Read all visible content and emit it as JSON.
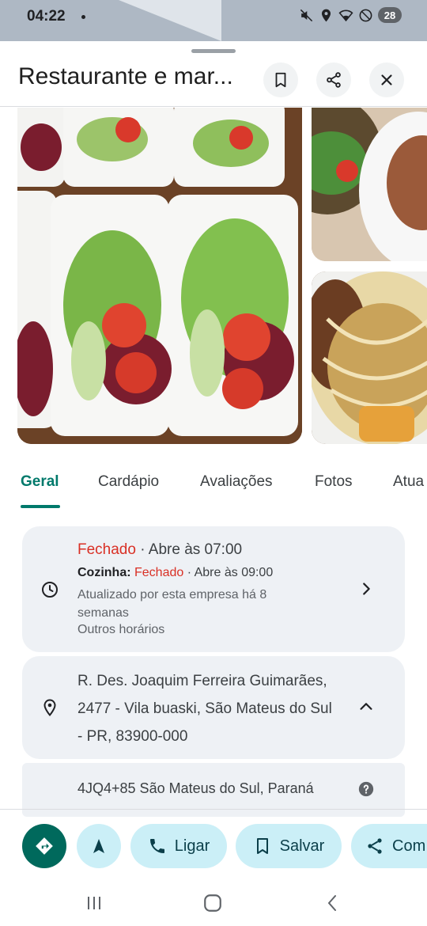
{
  "status_bar": {
    "time": "04:22",
    "battery": "28"
  },
  "header": {
    "title": "Restaurante e mar...",
    "icons": [
      "bookmark-icon",
      "share-icon",
      "close-icon"
    ]
  },
  "tabs": [
    {
      "label": "Geral",
      "active": true
    },
    {
      "label": "Cardápio"
    },
    {
      "label": "Avaliações"
    },
    {
      "label": "Fotos"
    },
    {
      "label": "Atua"
    }
  ],
  "hours": {
    "status": "Fechado",
    "opens": " · Abre às 07:00",
    "kitchen_label": "Cozinha: ",
    "kitchen_status": "Fechado",
    "kitchen_opens": " · Abre às 09:00",
    "updated": "Atualizado por esta empresa há 8 semanas",
    "more": "Outros horários"
  },
  "address": {
    "text": "R. Des. Joaquim Ferreira Guimarães, 2477 - Vila buaski, São Mateus do Sul - PR, 83900-000"
  },
  "plus_code": {
    "text": "4JQ4+85 São Mateus do Sul, Paraná"
  },
  "actions": {
    "call": "Ligar",
    "save": "Salvar",
    "share": "Com"
  },
  "colors": {
    "accent": "#00796b",
    "closed": "#d93025",
    "pill": "#cbeff7"
  }
}
